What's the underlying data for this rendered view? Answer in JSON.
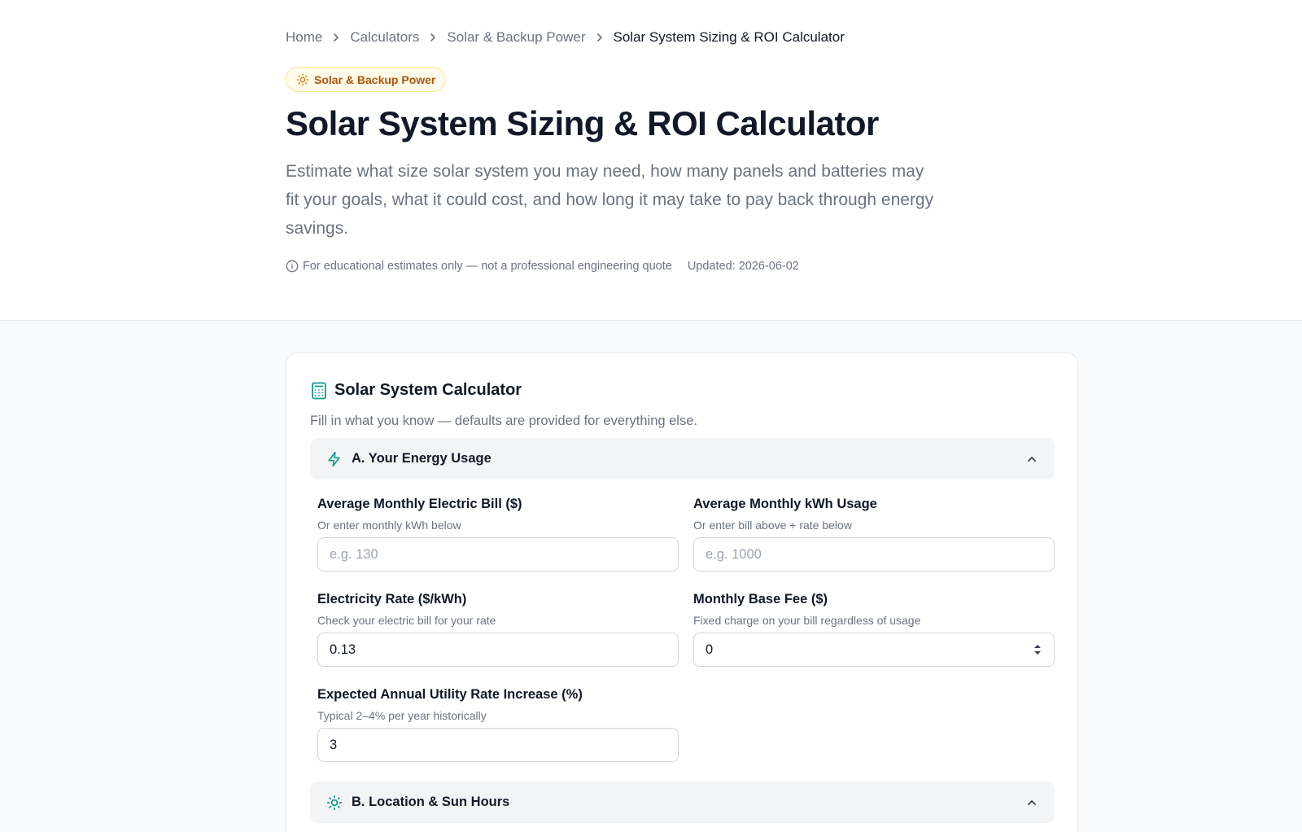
{
  "breadcrumb": {
    "home": "Home",
    "calculators": "Calculators",
    "category": "Solar & Backup Power",
    "current": "Solar System Sizing & ROI Calculator"
  },
  "badge": {
    "label": "Solar & Backup Power"
  },
  "page": {
    "title": "Solar System Sizing & ROI Calculator",
    "description": "Estimate what size solar system you may need, how many panels and batteries may fit your goals, what it could cost, and how long it may take to pay back through energy savings.",
    "disclaimer": "For educational estimates only — not a professional engineering quote",
    "updated": "Updated: 2026-06-02"
  },
  "calculator": {
    "title": "Solar System Calculator",
    "subtitle": "Fill in what you know — defaults are provided for everything else.",
    "sections": [
      {
        "label": "A. Your Energy Usage",
        "icon": "lightning-icon",
        "expanded": true
      },
      {
        "label": "B. Location & Sun Hours",
        "icon": "sun-icon",
        "expanded": true
      }
    ],
    "fields": {
      "monthly_bill": {
        "label": "Average Monthly Electric Bill ($)",
        "hint": "Or enter monthly kWh below",
        "placeholder": "e.g. 130",
        "value": ""
      },
      "monthly_kwh": {
        "label": "Average Monthly kWh Usage",
        "hint": "Or enter bill above + rate below",
        "placeholder": "e.g. 1000",
        "value": ""
      },
      "rate": {
        "label": "Electricity Rate ($/kWh)",
        "hint": "Check your electric bill for your rate",
        "value": "0.13"
      },
      "base_fee": {
        "label": "Monthly Base Fee ($)",
        "hint": "Fixed charge on your bill regardless of usage",
        "value": "0"
      },
      "rate_increase": {
        "label": "Expected Annual Utility Rate Increase (%)",
        "hint": "Typical 2–4% per year historically",
        "value": "3"
      }
    }
  },
  "colors": {
    "accent": "#0f9b8e",
    "badge_text": "#b45309",
    "badge_bg": "#fffbeb"
  }
}
